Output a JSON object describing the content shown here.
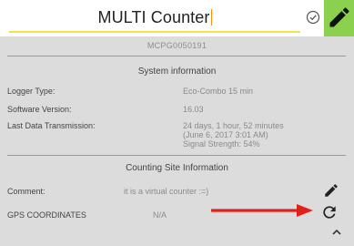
{
  "header": {
    "title": "MULTI Counter",
    "check_icon": "check-circle-icon",
    "edit_icon": "pencil-icon",
    "accent": "#8bd04f",
    "underline": "#f0e44a"
  },
  "serial": "MCPG0050191",
  "system": {
    "title": "System information",
    "rows": [
      {
        "label": "Logger Type:",
        "value_lines": [
          "Eco-Combo 15 min"
        ]
      },
      {
        "label": "Software Version:",
        "value_lines": [
          "16.03"
        ]
      },
      {
        "label": "Last Data Transmission:",
        "value_lines": [
          "24 days, 1 hour, 52 minutes",
          "(June 6, 2017 3:01 AM)",
          "Signal Strength: 54%"
        ]
      }
    ]
  },
  "counting": {
    "title": "Counting Site Information",
    "comment_label": "Comment:",
    "comment_value": "it is a virtual counter :=)",
    "gps_label": "GPS COORDINATES",
    "gps_value": "N/A",
    "arrow_color": "#e0201a"
  }
}
